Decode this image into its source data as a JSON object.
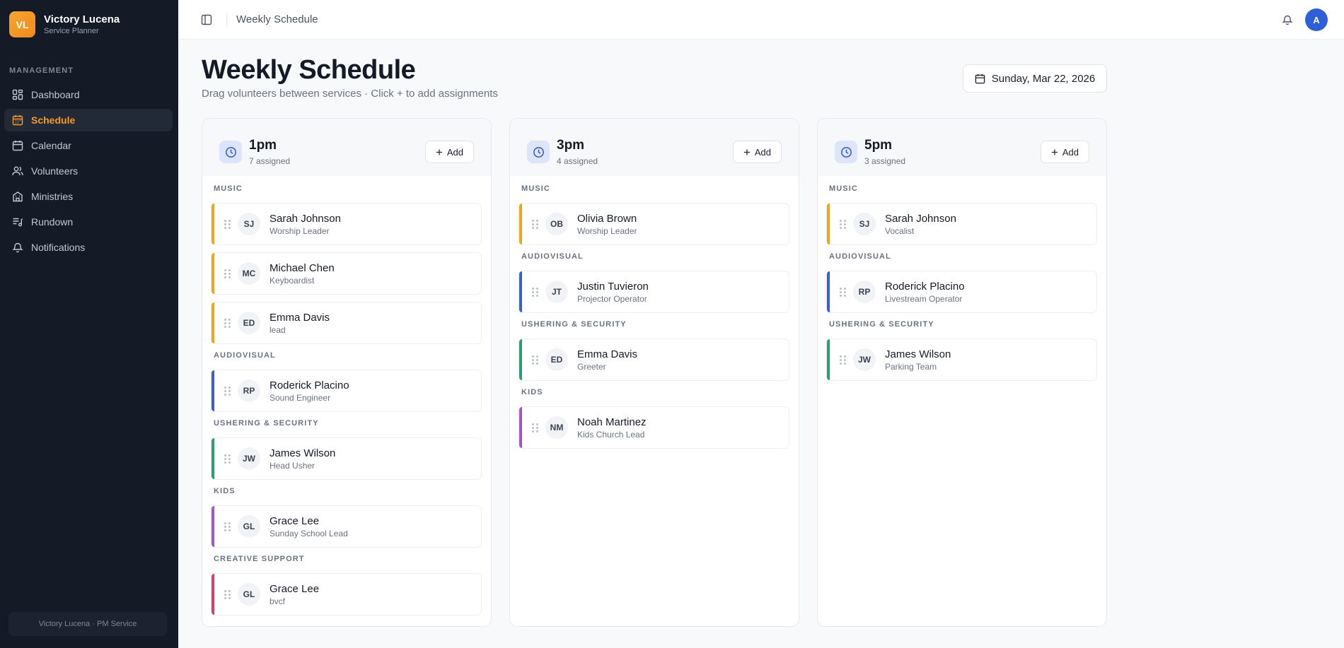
{
  "brand": {
    "initials": "VL",
    "name": "Victory Lucena",
    "subtitle": "Service Planner"
  },
  "nav": {
    "section": "MANAGEMENT",
    "items": [
      {
        "label": "Dashboard",
        "icon": "dashboard-icon",
        "active": false
      },
      {
        "label": "Schedule",
        "icon": "calendar-grid-icon",
        "active": true
      },
      {
        "label": "Calendar",
        "icon": "calendar-icon",
        "active": false
      },
      {
        "label": "Volunteers",
        "icon": "users-icon",
        "active": false
      },
      {
        "label": "Ministries",
        "icon": "building-icon",
        "active": false
      },
      {
        "label": "Rundown",
        "icon": "list-music-icon",
        "active": false
      },
      {
        "label": "Notifications",
        "icon": "bell-icon",
        "active": false
      }
    ],
    "footer": "Victory Lucena · PM Service"
  },
  "topbar": {
    "breadcrumb": "Weekly Schedule",
    "avatar": "A"
  },
  "header": {
    "title": "Weekly Schedule",
    "subtitle": "Drag volunteers between services · Click + to add assignments",
    "date": "Sunday, Mar 22, 2026"
  },
  "colors": {
    "accent": "#f59a26",
    "music": "#f0a520",
    "audiovisual": "#3b5fc9",
    "ushering": "#2f9e6e",
    "kids": "#a256c9",
    "creative": "#d2406c"
  },
  "columns": [
    {
      "time": "1pm",
      "count": "7 assigned",
      "add_label": "Add",
      "groups": [
        {
          "label": "MUSIC",
          "color": "#f0a520",
          "people": [
            {
              "initials": "SJ",
              "name": "Sarah Johnson",
              "role": "Worship Leader"
            },
            {
              "initials": "MC",
              "name": "Michael Chen",
              "role": "Keyboardist"
            },
            {
              "initials": "ED",
              "name": "Emma Davis",
              "role": "lead"
            }
          ]
        },
        {
          "label": "AUDIOVISUAL",
          "color": "#3b5fc9",
          "people": [
            {
              "initials": "RP",
              "name": "Roderick Placino",
              "role": "Sound Engineer"
            }
          ]
        },
        {
          "label": "USHERING & SECURITY",
          "color": "#2f9e6e",
          "people": [
            {
              "initials": "JW",
              "name": "James Wilson",
              "role": "Head Usher"
            }
          ]
        },
        {
          "label": "KIDS",
          "color": "#a256c9",
          "people": [
            {
              "initials": "GL",
              "name": "Grace Lee",
              "role": "Sunday School Lead"
            }
          ]
        },
        {
          "label": "CREATIVE SUPPORT",
          "color": "#d2406c",
          "people": [
            {
              "initials": "GL",
              "name": "Grace Lee",
              "role": "bvcf"
            }
          ]
        }
      ]
    },
    {
      "time": "3pm",
      "count": "4 assigned",
      "add_label": "Add",
      "groups": [
        {
          "label": "MUSIC",
          "color": "#f0a520",
          "people": [
            {
              "initials": "OB",
              "name": "Olivia Brown",
              "role": "Worship Leader"
            }
          ]
        },
        {
          "label": "AUDIOVISUAL",
          "color": "#3b5fc9",
          "people": [
            {
              "initials": "JT",
              "name": "Justin Tuvieron",
              "role": "Projector Operator"
            }
          ]
        },
        {
          "label": "USHERING & SECURITY",
          "color": "#2f9e6e",
          "people": [
            {
              "initials": "ED",
              "name": "Emma Davis",
              "role": "Greeter"
            }
          ]
        },
        {
          "label": "KIDS",
          "color": "#a256c9",
          "people": [
            {
              "initials": "NM",
              "name": "Noah Martinez",
              "role": "Kids Church Lead"
            }
          ]
        }
      ]
    },
    {
      "time": "5pm",
      "count": "3 assigned",
      "add_label": "Add",
      "groups": [
        {
          "label": "MUSIC",
          "color": "#f0a520",
          "people": [
            {
              "initials": "SJ",
              "name": "Sarah Johnson",
              "role": "Vocalist"
            }
          ]
        },
        {
          "label": "AUDIOVISUAL",
          "color": "#3b5fc9",
          "people": [
            {
              "initials": "RP",
              "name": "Roderick Placino",
              "role": "Livestream Operator"
            }
          ]
        },
        {
          "label": "USHERING & SECURITY",
          "color": "#2f9e6e",
          "people": [
            {
              "initials": "JW",
              "name": "James Wilson",
              "role": "Parking Team"
            }
          ]
        }
      ]
    }
  ]
}
